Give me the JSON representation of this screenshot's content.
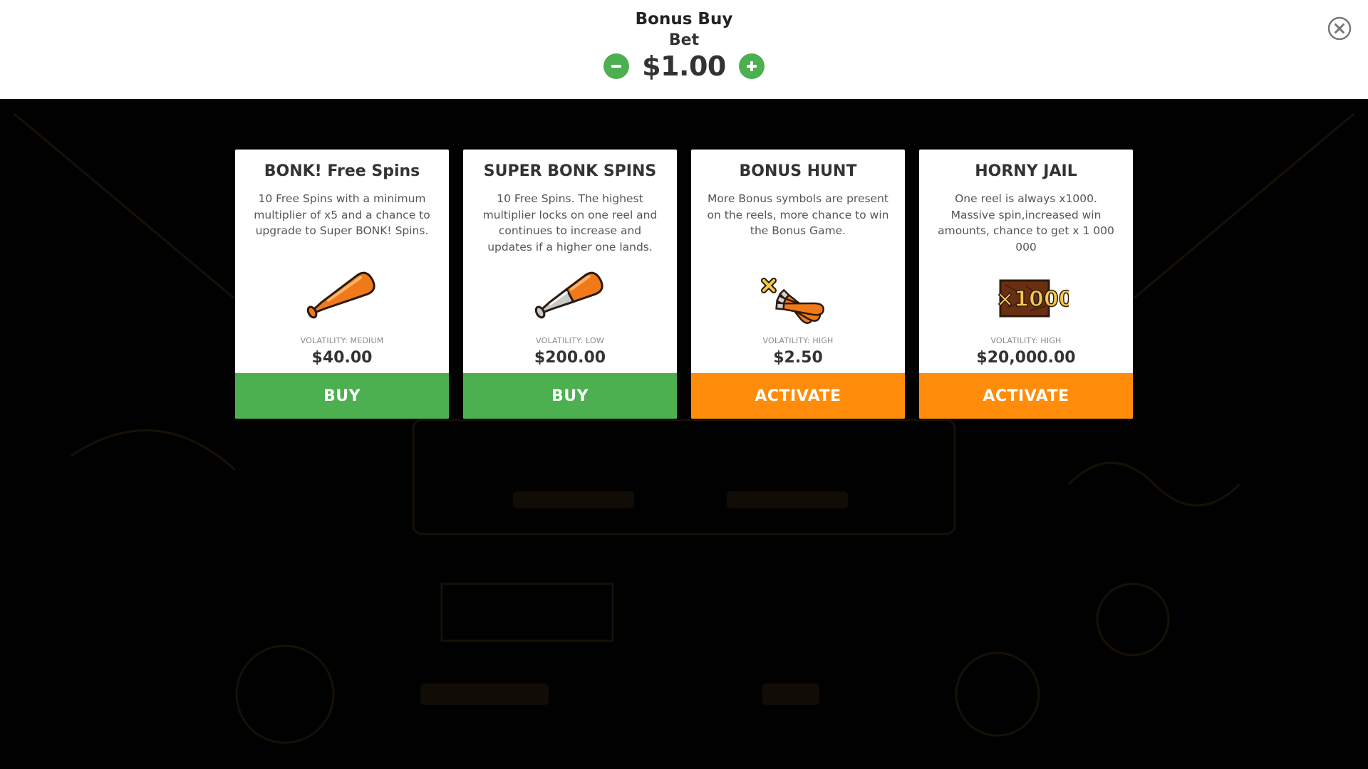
{
  "header": {
    "title": "Bonus Buy",
    "bet_label": "Bet",
    "bet_value": "$1.00"
  },
  "colors": {
    "accent_green": "#4caf50",
    "accent_orange": "#ff8c0a",
    "text_dark": "#333333"
  },
  "cards": [
    {
      "title": "BONK! Free Spins",
      "description": "10 Free Spins with a minimum multiplier of x5 and a chance to upgrade to Super BONK! Spins.",
      "icon": "orange-bat-icon",
      "volatility": "VOLATILITY: MEDIUM",
      "price": "$40.00",
      "button_label": "BUY"
    },
    {
      "title": "SUPER BONK SPINS",
      "description": "10 Free Spins. The highest multiplier locks on one reel and continues to increase and updates if a higher one lands.",
      "icon": "silver-orange-bat-icon",
      "volatility": "VOLATILITY: LOW",
      "price": "$200.00",
      "button_label": "BUY"
    },
    {
      "title": "BONUS HUNT",
      "description": "More Bonus symbols are present on the reels, more chance to win the Bonus Game.",
      "icon": "multiple-bats-icon",
      "volatility": "VOLATILITY: HIGH",
      "price": "$2.50",
      "button_label": "ACTIVATE"
    },
    {
      "title": "HORNY JAIL",
      "description": "One reel is always x1000. Massive spin,increased win amounts, chance to get x 1 000 000",
      "icon": "x1000-multiplier-icon",
      "icon_text": "×1000",
      "volatility": "VOLATILITY: HIGH",
      "price": "$20,000.00",
      "button_label": "ACTIVATE"
    }
  ]
}
